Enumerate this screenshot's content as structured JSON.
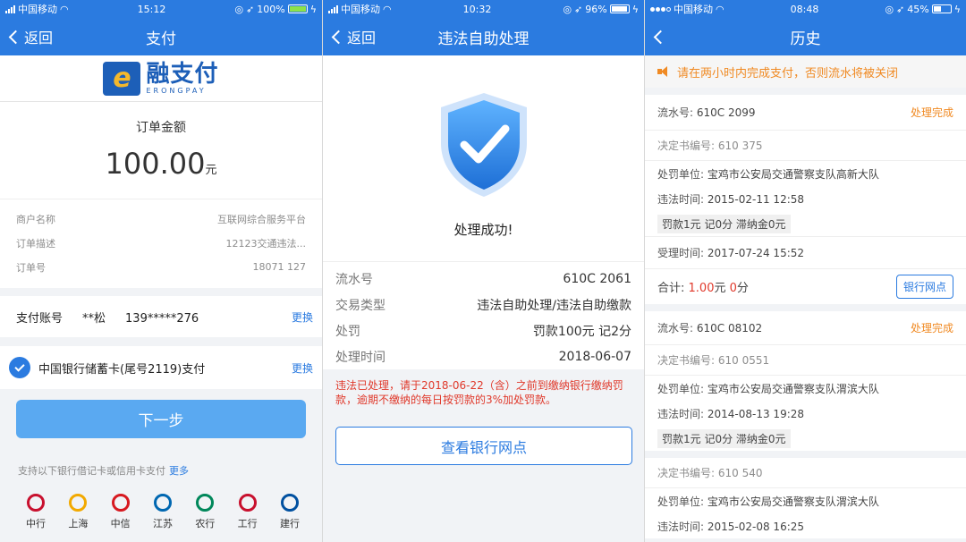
{
  "screens": [
    {
      "status": {
        "carrier": "中国移动",
        "time": "15:12",
        "battery": "100%"
      },
      "nav": {
        "back_label": "返回",
        "title": "支付"
      },
      "logo": {
        "cn": "融支付",
        "en": "ERONGPAY"
      },
      "amount_label": "订单金额",
      "amount": "100.00",
      "amount_unit": "元",
      "info_rows": [
        {
          "label": "商户名称",
          "value": "互联网综合服务平台"
        },
        {
          "label": "订单描述",
          "value": "12123交通违法..."
        },
        {
          "label": "订单号",
          "value": "18071 127"
        }
      ],
      "account": {
        "label": "支付账号",
        "name": "**松",
        "number": "139*****276",
        "change": "更换"
      },
      "card": {
        "text": "中国银行储蓄卡(尾号2119)支付",
        "change": "更换"
      },
      "next_button": "下一步",
      "support_text": "支持以下银行借记卡或信用卡支付",
      "support_more": "更多",
      "banks": [
        {
          "name": "中行",
          "color": "#c8102e"
        },
        {
          "name": "上海",
          "color": "#f2a900"
        },
        {
          "name": "中信",
          "color": "#d71920"
        },
        {
          "name": "江苏",
          "color": "#0067b1"
        },
        {
          "name": "农行",
          "color": "#00875a"
        },
        {
          "name": "工行",
          "color": "#c8102e"
        },
        {
          "name": "建行",
          "color": "#0050a0"
        }
      ]
    },
    {
      "status": {
        "carrier": "中国移动",
        "time": "10:32",
        "battery": "96%"
      },
      "nav": {
        "back_label": "返回",
        "title": "违法自助处理"
      },
      "success_text": "处理成功!",
      "details": [
        {
          "label": "流水号",
          "value": "610C  2061"
        },
        {
          "label": "交易类型",
          "value": "违法自助处理/违法自助缴款"
        },
        {
          "label": "处罚",
          "value": "罚款100元 记2分"
        },
        {
          "label": "处理时间",
          "value": "2018-06-07"
        }
      ],
      "notice": "违法已处理，请于2018-06-22（含）之前到缴纳银行缴纳罚款，逾期不缴纳的每日按罚款的3%加处罚款。",
      "bank_button": "查看银行网点"
    },
    {
      "status": {
        "carrier": "中国移动",
        "time": "08:48",
        "battery": "45%"
      },
      "nav": {
        "title": "历史"
      },
      "warning": "请在两小时内完成支付，否则流水将被关闭",
      "records": [
        {
          "serial_label": "流水号:",
          "serial": "610C 2099",
          "status": "处理完成",
          "decision_label": "决定书编号:",
          "decision": "610 375",
          "unit_label": "处罚单位:",
          "unit": "宝鸡市公安局交通警察支队高新大队",
          "time_label": "违法时间:",
          "time": "2015-02-11 12:58",
          "fee": "罚款1元 记0分 滞纳金0元",
          "accept_label": "受理时间:",
          "accept_time": "2017-07-24 15:52",
          "total_label": "合计:",
          "total_yuan": "1.00",
          "yuan_unit": "元",
          "total_fen": "0",
          "fen_unit": "分",
          "bank_button": "银行网点"
        },
        {
          "serial_label": "流水号:",
          "serial": "610C 08102",
          "status": "处理完成",
          "decision_label": "决定书编号:",
          "decision": "610 0551",
          "unit_label": "处罚单位:",
          "unit": "宝鸡市公安局交通警察支队渭滨大队",
          "time_label": "违法时间:",
          "time": "2014-08-13 19:28",
          "fee": "罚款1元 记0分 滞纳金0元"
        },
        {
          "decision_label": "决定书编号:",
          "decision": "610 540",
          "unit_label": "处罚单位:",
          "unit": "宝鸡市公安局交通警察支队渭滨大队",
          "time_label": "违法时间:",
          "time": "2015-02-08 16:25"
        }
      ]
    }
  ]
}
